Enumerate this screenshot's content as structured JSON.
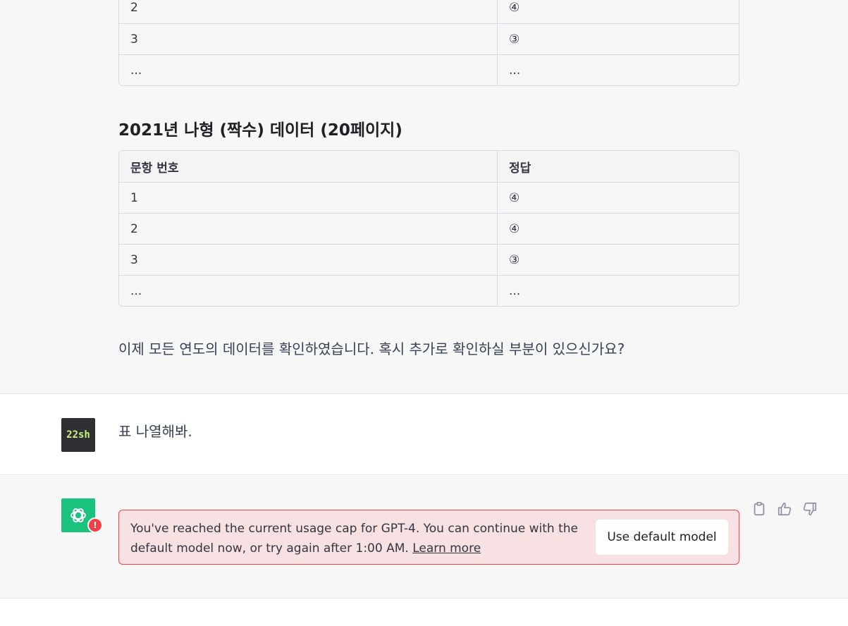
{
  "table_top": {
    "rows": [
      {
        "q": "2",
        "a": "④"
      },
      {
        "q": "3",
        "a": "③"
      },
      {
        "q": "...",
        "a": "..."
      }
    ]
  },
  "section": {
    "heading": "2021년 나형 (짝수) 데이터 (20페이지)"
  },
  "table_main": {
    "headers": {
      "q": "문항 번호",
      "a": "정답"
    },
    "rows": [
      {
        "q": "1",
        "a": "④"
      },
      {
        "q": "2",
        "a": "④"
      },
      {
        "q": "3",
        "a": "③"
      },
      {
        "q": "...",
        "a": "..."
      }
    ]
  },
  "closing_text": "이제 모든 연도의 데이터를 확인하였습니다. 혹시 추가로 확인하실 부분이 있으신가요?",
  "user_message": {
    "avatar_text": "22sh",
    "text": "표 나열해봐."
  },
  "error": {
    "badge": "!",
    "message": "You've reached the current usage cap for GPT-4. You can continue with the default model now, or try again after 1:00 AM.",
    "link": "Learn more",
    "button": "Use default model"
  },
  "icons": {
    "copy": "clipboard-icon",
    "like": "thumbs-up-icon",
    "dislike": "thumbs-down-icon",
    "assistant": "openai-logo-icon"
  },
  "colors": {
    "assistant_bg": "#f7f7f8",
    "gpt_green": "#19c37d",
    "error_red": "#ef4146",
    "error_bg": "#f8e1e2"
  }
}
